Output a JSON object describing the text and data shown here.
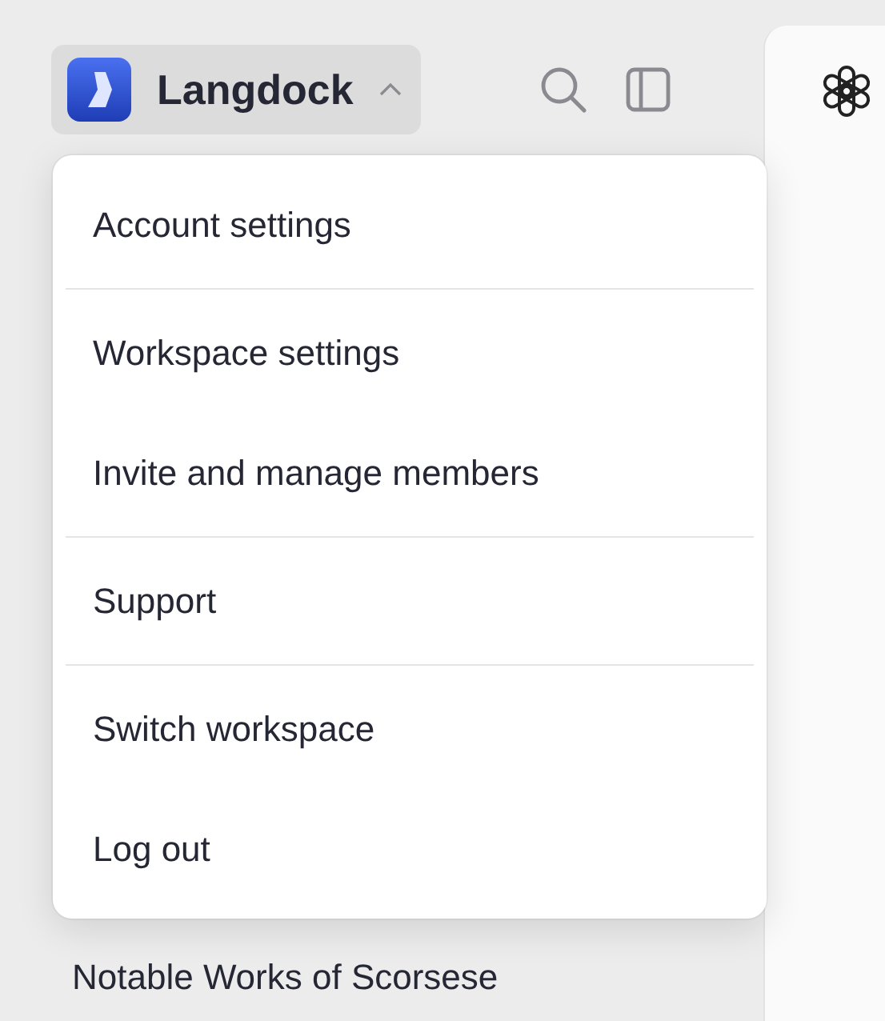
{
  "workspace_button": {
    "name": "Langdock",
    "expanded": true
  },
  "menu": {
    "groups": [
      {
        "items": [
          "Account settings"
        ]
      },
      {
        "items": [
          "Workspace settings",
          "Invite and manage members"
        ]
      },
      {
        "items": [
          "Support"
        ]
      },
      {
        "items": [
          "Switch workspace",
          "Log out"
        ]
      }
    ]
  },
  "chats": [
    "Notable Works of Scorsese"
  ]
}
